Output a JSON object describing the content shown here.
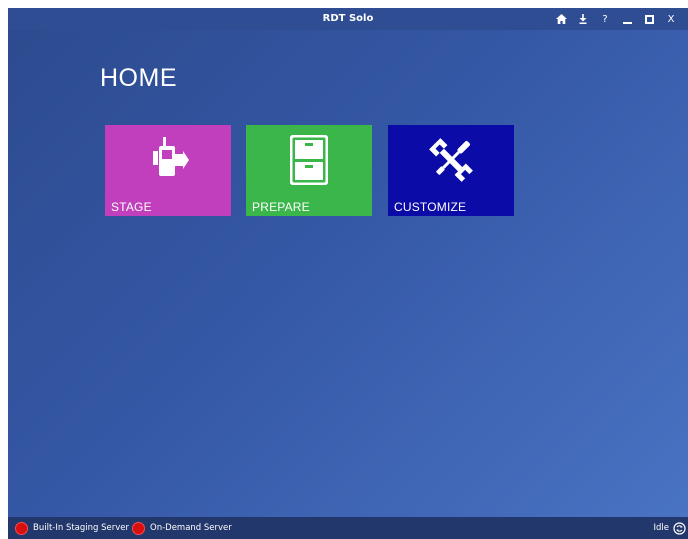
{
  "window": {
    "title": "RDT Solo",
    "controls": {
      "home": "home-icon",
      "download": "download-icon",
      "help": "?",
      "minimize": "minimize-icon",
      "maximize": "maximize-icon",
      "close": "X"
    }
  },
  "main": {
    "page_title": "HOME",
    "tiles": [
      {
        "label": "STAGE",
        "icon": "device-arrow-icon",
        "color": "#c13fbd"
      },
      {
        "label": "PREPARE",
        "icon": "file-cabinet-icon",
        "color": "#3ab64a"
      },
      {
        "label": "CUSTOMIZE",
        "icon": "tools-icon",
        "color": "#0b0ba8"
      }
    ]
  },
  "statusbar": {
    "servers": [
      {
        "label": "Built-In Staging Server",
        "status_color": "#d80f0f"
      },
      {
        "label": "On-Demand Server",
        "status_color": "#d80f0f"
      }
    ],
    "state": "Idle"
  }
}
